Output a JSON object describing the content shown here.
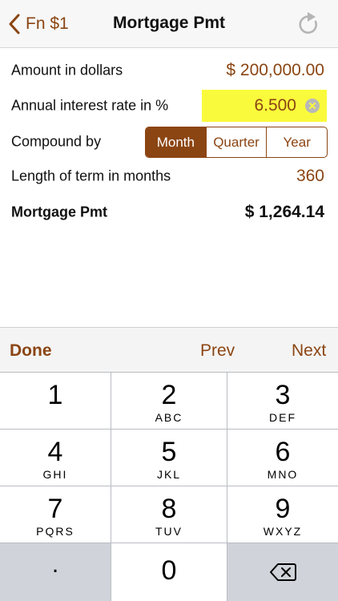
{
  "nav": {
    "back_label": "Fn $1",
    "title": "Mortgage Pmt",
    "refresh_icon": "refresh-icon"
  },
  "form": {
    "amount": {
      "label": "Amount in dollars",
      "value": "$ 200,000.00"
    },
    "rate": {
      "label": "Annual interest rate in %",
      "value": "6.500"
    },
    "compound": {
      "label": "Compound by",
      "options": [
        "Month",
        "Quarter",
        "Year"
      ],
      "selected": "Month"
    },
    "term": {
      "label": "Length of term in months",
      "value": "360"
    },
    "result": {
      "label": "Mortgage Pmt",
      "value": "$ 1,264.14"
    }
  },
  "accessory": {
    "done": "Done",
    "prev": "Prev",
    "next": "Next"
  },
  "keypad": {
    "keys": [
      {
        "digit": "1",
        "letters": ""
      },
      {
        "digit": "2",
        "letters": "ABC"
      },
      {
        "digit": "3",
        "letters": "DEF"
      },
      {
        "digit": "4",
        "letters": "GHI"
      },
      {
        "digit": "5",
        "letters": "JKL"
      },
      {
        "digit": "6",
        "letters": "MNO"
      },
      {
        "digit": "7",
        "letters": "PQRS"
      },
      {
        "digit": "8",
        "letters": "TUV"
      },
      {
        "digit": "9",
        "letters": "WXYZ"
      }
    ],
    "decimal": ".",
    "zero": "0",
    "delete_icon": "backspace-icon"
  },
  "colors": {
    "accent": "#8b4513",
    "highlight": "#fafa3c",
    "keypad_bg": "#b9bcc2"
  }
}
